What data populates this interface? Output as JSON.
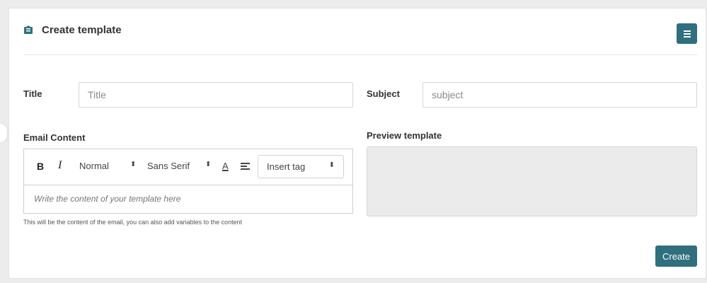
{
  "header": {
    "title": "Create template",
    "icon": "envelope-open-icon",
    "menu_icon": "hamburger-menu-icon"
  },
  "form": {
    "title_label": "Title",
    "title_placeholder": "Title",
    "subject_label": "Subject",
    "subject_placeholder": "subject",
    "content_label": "Email Content",
    "preview_label": "Preview template",
    "helper_text": "This will be the content of the email, you can also add variables to the content"
  },
  "editor": {
    "bold_label": "B",
    "italic_label": "I",
    "size_value": "Normal",
    "font_value": "Sans Serif",
    "color_label": "A",
    "insert_tag_label": "Insert tag",
    "select_arrows": "⬍",
    "placeholder": "Write the content of your template here"
  },
  "actions": {
    "create_label": "Create"
  },
  "colors": {
    "accent": "#2f6f7e",
    "preview_bg": "#ebebeb",
    "page_bg": "#ececec"
  }
}
